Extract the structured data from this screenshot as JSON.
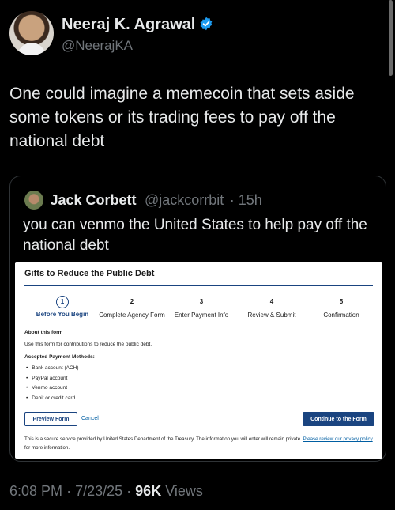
{
  "author": {
    "name": "Neeraj K. Agrawal",
    "handle": "@NeerajKA",
    "verified": true,
    "avatar_icon": "profile-photo"
  },
  "tweet": {
    "text": "One could imagine a memecoin that sets aside some tokens or its trading fees to pay off the national debt"
  },
  "quoted": {
    "name": "Jack Corbett",
    "handle": "@jackcorrbit",
    "time": "· 15h",
    "text": "you can venmo the United States to help pay off the national debt",
    "form": {
      "title": "Gifts to Reduce the Public Debt",
      "steps": [
        {
          "num": "1",
          "label": "Before You Begin"
        },
        {
          "num": "2",
          "label": "Complete Agency Form"
        },
        {
          "num": "3",
          "label": "Enter Payment Info"
        },
        {
          "num": "4",
          "label": "Review & Submit"
        },
        {
          "num": "5",
          "label": "Confirmation"
        }
      ],
      "about_title": "About this form",
      "about_text": "Use this form for contributions to reduce the public debt.",
      "methods_title": "Accepted Payment Methods:",
      "methods": [
        "Bank account (ACH)",
        "PayPal account",
        "Venmo account",
        "Debit or credit card"
      ],
      "preview_label": "Preview Form",
      "cancel_label": "Cancel",
      "continue_label": "Continue to the Form",
      "footnote": "This is a secure service provided by United States Department of the Treasury. The information you will enter will remain private.",
      "footnote_link": "Please review our privacy policy",
      "footnote_end": "for more information."
    }
  },
  "meta": {
    "time": "6:08 PM",
    "date": "7/23/25",
    "views_count": "96K",
    "views_label": "Views"
  },
  "colors": {
    "background": "#000000",
    "text": "#e7e9ea",
    "muted": "#71767b",
    "verified": "#1d9bf0",
    "gov_blue": "#1a4480"
  }
}
